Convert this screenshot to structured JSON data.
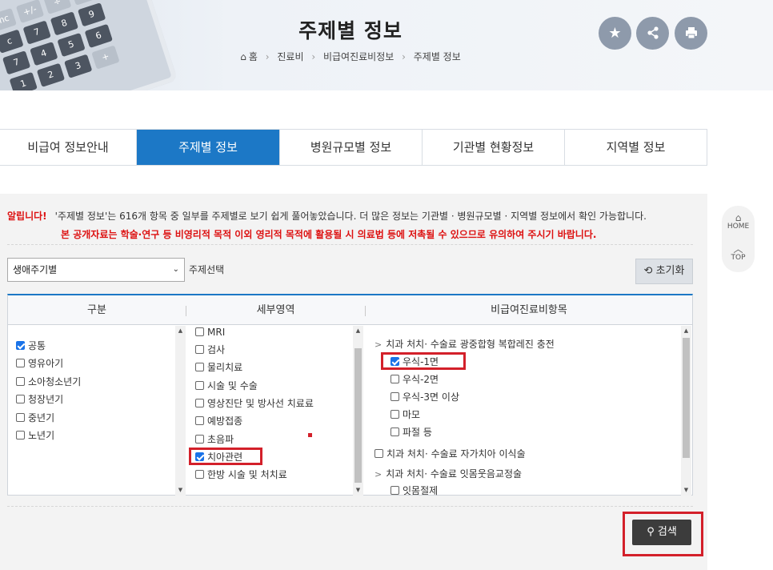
{
  "header": {
    "title": "주제별 정보",
    "breadcrumb": [
      "홈",
      "진료비",
      "비급여진료비정보",
      "주제별 정보"
    ],
    "actions": [
      "bookmark",
      "share",
      "print"
    ]
  },
  "tabs": [
    {
      "label": "비급여 정보안내",
      "active": false
    },
    {
      "label": "주제별 정보",
      "active": true
    },
    {
      "label": "병원규모별 정보",
      "active": false
    },
    {
      "label": "기관별 현황정보",
      "active": false
    },
    {
      "label": "지역별 정보",
      "active": false
    }
  ],
  "notice": {
    "alert_label": "알립니다!",
    "line1": "'주제별 정보'는 616개 항목 중 일부를 주제별로 보기 쉽게 풀어놓았습니다. 더 많은 정보는 기관별 · 병원규모별 · 지역별 정보에서 확인 가능합니다.",
    "line2": "본 공개자료는 학술·연구 등 비영리적 목적 이외 영리적 목적에 활용될 시 의료법 등에 저촉될 수 있으므로 유의하여 주시기 바랍니다."
  },
  "filter": {
    "select_value": "생애주기별",
    "select_label": "주제선택",
    "reset_label": "초기화"
  },
  "grid": {
    "headers": [
      "구분",
      "세부영역",
      "비급여진료비항목"
    ],
    "category": [
      {
        "label": "공통",
        "checked": true
      },
      {
        "label": "영유아기",
        "checked": false
      },
      {
        "label": "소아청소년기",
        "checked": false
      },
      {
        "label": "청장년기",
        "checked": false
      },
      {
        "label": "중년기",
        "checked": false
      },
      {
        "label": "노년기",
        "checked": false
      }
    ],
    "subarea": [
      {
        "label": "MRI",
        "checked": false
      },
      {
        "label": "검사",
        "checked": false
      },
      {
        "label": "물리치료",
        "checked": false
      },
      {
        "label": "시술 및 수술",
        "checked": false
      },
      {
        "label": "영상진단 및 방사선 치료료",
        "checked": false
      },
      {
        "label": "예방접종",
        "checked": false
      },
      {
        "label": "초음파",
        "checked": false
      },
      {
        "label": "치아관련",
        "checked": true
      },
      {
        "label": "한방 시술 및 처치료",
        "checked": false
      }
    ],
    "items": [
      {
        "label": "치과 처치· 수술료 광중합형 복합레진 충전",
        "type": "group"
      },
      {
        "label": "우식-1면",
        "type": "child",
        "checked": true
      },
      {
        "label": "우식-2면",
        "type": "child",
        "checked": false
      },
      {
        "label": "우식-3면 이상",
        "type": "child",
        "checked": false
      },
      {
        "label": "마모",
        "type": "child",
        "checked": false
      },
      {
        "label": "파절 등",
        "type": "child",
        "checked": false
      },
      {
        "label": "치과 처치· 수술료 자가치아 이식술",
        "type": "single",
        "checked": false
      },
      {
        "label": "치과 처치· 수술료 잇몸웃음교정술",
        "type": "group"
      },
      {
        "label": "잇몸절제",
        "type": "child",
        "checked": false
      }
    ]
  },
  "search_label": "검색",
  "quickbar": {
    "home": "HOME",
    "top": "TOP"
  },
  "colors": {
    "accent": "#1c78c6",
    "highlight": "#d3202a",
    "alert": "#dd1111"
  }
}
